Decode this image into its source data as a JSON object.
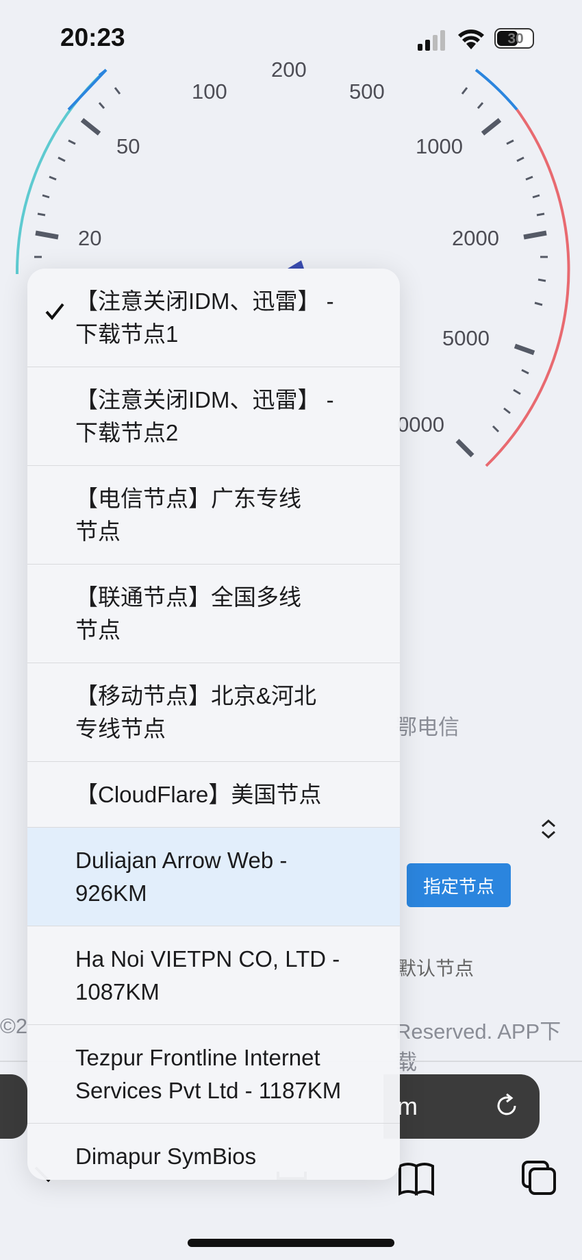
{
  "status_bar": {
    "time": "20:23",
    "battery": "30"
  },
  "gauge": {
    "labels": [
      "200",
      "100",
      "500",
      "50",
      "1000",
      "20",
      "2000",
      "5000",
      "0000"
    ],
    "colors": {
      "arc_left": "#5ecad0",
      "arc_blue": "#2b85de",
      "arc_right": "#e86a70",
      "needle": "#3a4cb0"
    }
  },
  "background": {
    "isp_fragment": "鄂电信",
    "specify_node_button": "指定节点",
    "default_node_fragment": "默认节点",
    "footer_left_fragment": "©2",
    "footer_right_fragment": "Reserved. APP下载",
    "url_fragment": "m"
  },
  "dropdown": {
    "selected_index": 0,
    "options": [
      "【注意关闭IDM、迅雷】 - 下载节点1",
      "【注意关闭IDM、迅雷】 - 下载节点2",
      "【电信节点】广东专线节点",
      "【联通节点】全国多线节点",
      "【移动节点】北京&河北专线节点",
      "【CloudFlare】美国节点",
      "Duliajan Arrow Web - 926KM",
      "Ha Noi VIETPN CO, LTD - 1087KM",
      "Tezpur Frontline Internet Services Pvt Ltd - 1187KM",
      "Dimapur SymBios"
    ],
    "lines": [
      [
        "【注意关闭IDM、迅雷】 -",
        "下载节点1"
      ],
      [
        "【注意关闭IDM、迅雷】 -",
        "下载节点2"
      ],
      [
        "【电信节点】广东专线",
        "节点"
      ],
      [
        "【联通节点】全国多线",
        "节点"
      ],
      [
        "【移动节点】北京&河北",
        "专线节点"
      ],
      [
        "【CloudFlare】美国节点"
      ],
      [
        "Duliajan Arrow Web -",
        "926KM"
      ],
      [
        "Ha Noi VIETPN CO, LTD -",
        "1087KM"
      ],
      [
        "Tezpur Frontline Internet",
        "Services Pvt Ltd - 1187KM"
      ],
      [
        "Dimapur SymBios"
      ]
    ],
    "highlight_color": "#e2eefb"
  },
  "toolbar_icons": [
    "back-icon",
    "tabs-icon",
    "bookmarks-icon",
    "tab-switcher-icon"
  ]
}
